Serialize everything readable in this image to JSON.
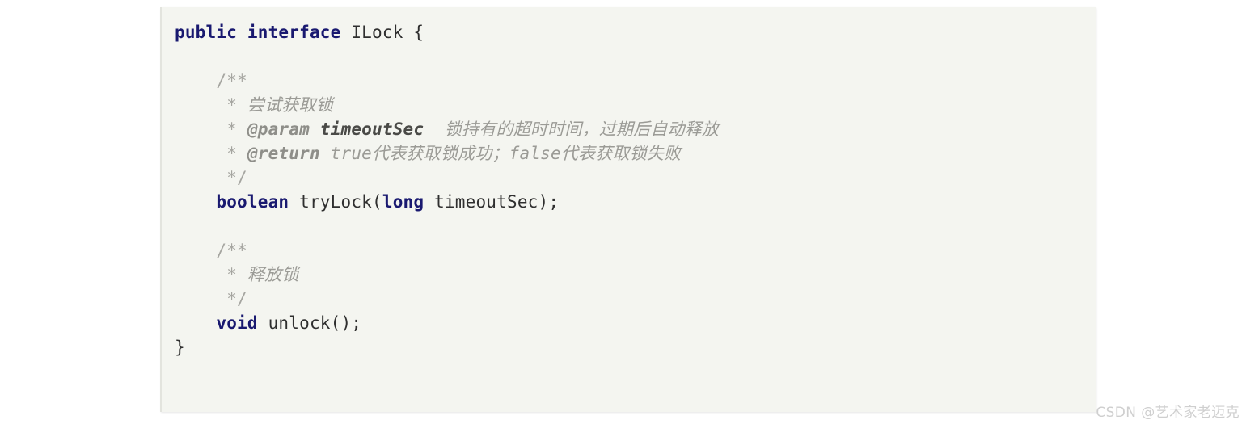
{
  "code_block": {
    "language": "java",
    "background_color": "#f4f5f0",
    "keyword_color": "#191970",
    "comment_color": "#9b9b96",
    "plain_color": "#2f2f2f",
    "lines": [
      {
        "id": "line-1",
        "indent": 0,
        "tokens": [
          {
            "text": "public",
            "type": "keyword"
          },
          {
            "text": " ",
            "type": "plain"
          },
          {
            "text": "interface",
            "type": "keyword"
          },
          {
            "text": " ILock {",
            "type": "plain"
          }
        ]
      },
      {
        "id": "line-2",
        "indent": 0,
        "tokens": [
          {
            "text": "",
            "type": "blank"
          }
        ]
      },
      {
        "id": "line-3",
        "indent": 4,
        "tokens": [
          {
            "text": "/**",
            "type": "comment-punct"
          }
        ]
      },
      {
        "id": "line-4",
        "indent": 5,
        "tokens": [
          {
            "text": "* ",
            "type": "comment-punct"
          },
          {
            "text": "尝试获取锁",
            "type": "comment"
          }
        ]
      },
      {
        "id": "line-5",
        "indent": 5,
        "tokens": [
          {
            "text": "* ",
            "type": "comment-punct"
          },
          {
            "text": "@param",
            "type": "comment-tag"
          },
          {
            "text": " ",
            "type": "comment"
          },
          {
            "text": "timeoutSec",
            "type": "comment-param"
          },
          {
            "text": "  锁持有的超时时间，过期后自动释放",
            "type": "comment"
          }
        ]
      },
      {
        "id": "line-6",
        "indent": 5,
        "tokens": [
          {
            "text": "* ",
            "type": "comment-punct"
          },
          {
            "text": "@return",
            "type": "comment-tag"
          },
          {
            "text": " true代表获取锁成功；false代表获取锁失败",
            "type": "comment"
          }
        ]
      },
      {
        "id": "line-7",
        "indent": 5,
        "tokens": [
          {
            "text": "*/",
            "type": "comment-punct"
          }
        ]
      },
      {
        "id": "line-8",
        "indent": 4,
        "tokens": [
          {
            "text": "boolean",
            "type": "keyword"
          },
          {
            "text": " tryLock(",
            "type": "plain"
          },
          {
            "text": "long",
            "type": "keyword"
          },
          {
            "text": " timeoutSec);",
            "type": "plain"
          }
        ]
      },
      {
        "id": "line-9",
        "indent": 0,
        "tokens": [
          {
            "text": "",
            "type": "blank"
          }
        ]
      },
      {
        "id": "line-10",
        "indent": 4,
        "tokens": [
          {
            "text": "/**",
            "type": "comment-punct"
          }
        ]
      },
      {
        "id": "line-11",
        "indent": 5,
        "tokens": [
          {
            "text": "* ",
            "type": "comment-punct"
          },
          {
            "text": "释放锁",
            "type": "comment"
          }
        ]
      },
      {
        "id": "line-12",
        "indent": 5,
        "tokens": [
          {
            "text": "*/",
            "type": "comment-punct"
          }
        ]
      },
      {
        "id": "line-13",
        "indent": 4,
        "tokens": [
          {
            "text": "void",
            "type": "keyword"
          },
          {
            "text": " unlock();",
            "type": "plain"
          }
        ]
      },
      {
        "id": "line-14",
        "indent": 0,
        "tokens": [
          {
            "text": "}",
            "type": "plain"
          }
        ]
      }
    ]
  },
  "watermark": {
    "text": "CSDN @艺术家老迈克"
  }
}
